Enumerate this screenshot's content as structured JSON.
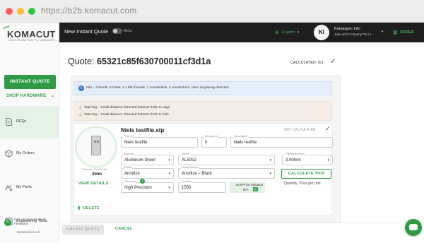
{
  "browser": {
    "url": "https://b2b.komacut.com"
  },
  "sidebar": {
    "logo_text": "KOMACUT",
    "logo_tagline": "• ELECTRICAL SHEET & HARDWARE •",
    "instant_quote_label": "INSTANT QUOTE",
    "shop_hardware_label": "SHOP HARDWARE",
    "items": [
      {
        "label": "RFQs",
        "icon": "document-icon"
      },
      {
        "label": "My Orders",
        "icon": "box-icon"
      },
      {
        "label": "My Parts",
        "icon": "parts-icon"
      },
      {
        "label": "Engineering Tools",
        "icon": "tools-icon"
      }
    ],
    "help_text": "Help us improve Send Feedback",
    "version": "Komacut v.1.1.3"
  },
  "topbar": {
    "new_quote_label": "New Instant Quote",
    "beta_label": "Beta",
    "language": "English",
    "user_initials": "KI",
    "user_name": "Komaspec Info",
    "user_company": "Jade and Company Pte Lt...",
    "order_label": "ORDER"
  },
  "quote": {
    "title_label": "Quote:",
    "id": "65321c85f630700011cf3d1a",
    "status": "CALCULATED",
    "status_count": "0/1"
  },
  "info_message": "Info – 2 bends, 6 holes, 2 x M6 threads, 1 countersink, 3 counterbore, laser engraving detected",
  "warnings": [
    "Warning – Small distance detected between hole to edge",
    "Warning – Small distance detected between hole to hole"
  ],
  "part": {
    "file_name": "Niels testfile.stp",
    "calc_status": "NOT CALCULATED",
    "thickness_label": "Selected Thickness",
    "thickness_value": "3mm",
    "view_details_label": "VIEW DETAILS →",
    "fields": {
      "part_number": {
        "label": "Part #",
        "value": "Niels testfile"
      },
      "revision": {
        "label": "Revision #",
        "value": "0"
      },
      "description": {
        "label": "Description",
        "value": "Niels testfile"
      },
      "material": {
        "label": "Material",
        "value": "Aluminum Sheet"
      },
      "series": {
        "label": "Series",
        "value": "AL5052"
      },
      "thickness": {
        "label": "Thickness (mm)",
        "value": "3.00mm"
      },
      "finish": {
        "label": "Finish",
        "value": "Anodize"
      },
      "finish_options": {
        "label": "Finish Options",
        "value": "Anodize – Black"
      },
      "tolerance": {
        "label": "Tolerance",
        "value": "High Precision"
      },
      "quantity": {
        "label": "Quantity",
        "value": "1550"
      }
    },
    "unit_price_variation_label": "Unit Price Variation",
    "unit_price_variation_value": "N/A",
    "calculate_label": "CALCULATE THIS",
    "quantity_price_label": "Quantity: Price per Unit",
    "delete_label": "DELETE"
  },
  "footer": {
    "create_quote_label": "CREATE QUOTE",
    "cancel_label": "CANCEL"
  },
  "colors": {
    "brand_green": "#2f9a45",
    "topbar_dark": "#1e1e1e",
    "info_blue": "#e4eefa",
    "warning_bg": "#f6ece6"
  }
}
